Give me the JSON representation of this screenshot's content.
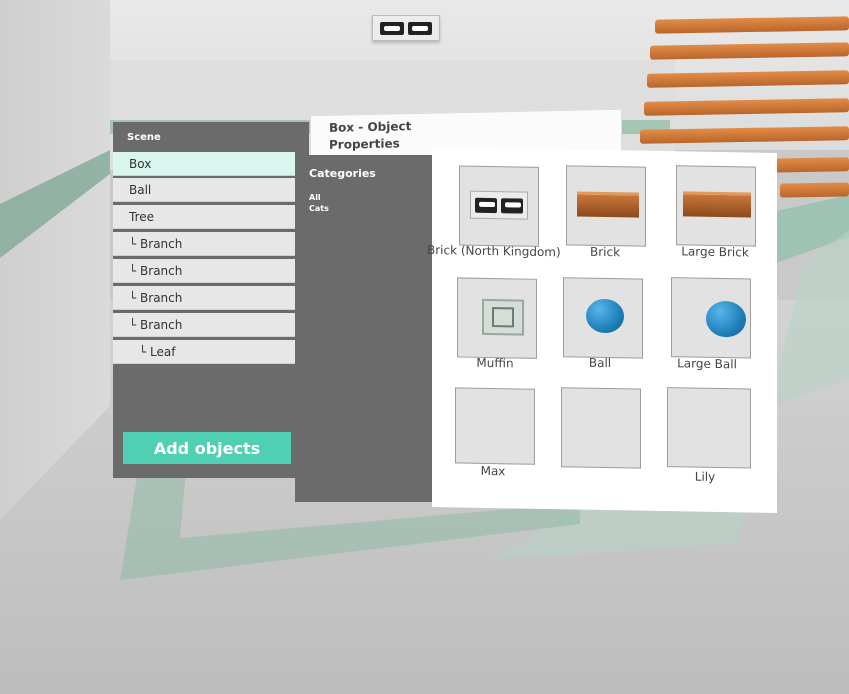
{
  "scene": {
    "title": "Scene",
    "items": [
      {
        "label": "Box"
      },
      {
        "label": "Ball"
      },
      {
        "label": "Tree"
      },
      {
        "label": "└ Branch"
      },
      {
        "label": "└ Branch"
      },
      {
        "label": "└ Branch"
      },
      {
        "label": "└ Branch"
      },
      {
        "label": "└ Leaf"
      }
    ],
    "add_button": "Add objects",
    "selected": "Box"
  },
  "properties": {
    "title": "Box - Object Properties"
  },
  "categories": {
    "title": "Categories",
    "items": [
      "All",
      "Cats"
    ]
  },
  "objects": [
    {
      "label": "Brick (North Kingdom)",
      "icon": "sign-icon"
    },
    {
      "label": "Brick",
      "icon": "brick-icon"
    },
    {
      "label": "Large Brick",
      "icon": "brick-icon"
    },
    {
      "label": "Muffin",
      "icon": "picture-icon"
    },
    {
      "label": "Ball",
      "icon": "ball-icon"
    },
    {
      "label": "Large Ball",
      "icon": "ball-icon"
    },
    {
      "label": "Max",
      "icon": ""
    },
    {
      "label": "",
      "icon": ""
    },
    {
      "label": "Lily",
      "icon": ""
    }
  ],
  "colors": {
    "accent": "#4fd0b3",
    "panel": "#6b6b6b",
    "selected": "#d8f5ee",
    "brick": "#b8662c",
    "ball": "#1e7fba"
  }
}
